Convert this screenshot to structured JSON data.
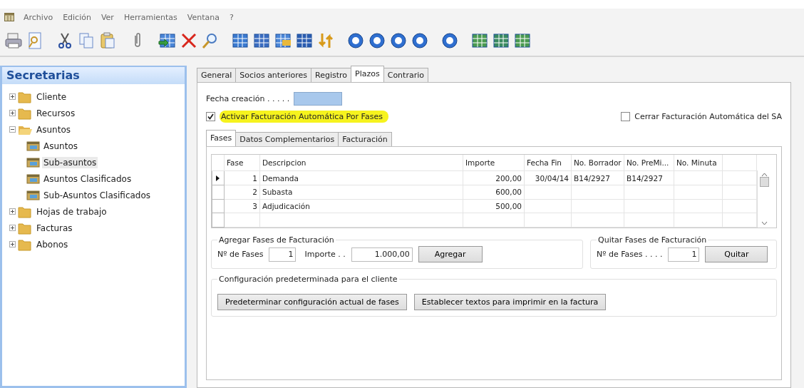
{
  "menu": [
    "Archivo",
    "Edición",
    "Ver",
    "Herramientas",
    "Ventana",
    "?"
  ],
  "sidebar": {
    "title": "Secretarias",
    "items": [
      {
        "label": "Cliente",
        "kind": "folder",
        "expanded": false
      },
      {
        "label": "Recursos",
        "kind": "folder",
        "expanded": false
      },
      {
        "label": "Asuntos",
        "kind": "folder",
        "expanded": true,
        "children": [
          {
            "label": "Asuntos",
            "kind": "table",
            "selected": false
          },
          {
            "label": "Sub-asuntos",
            "kind": "table",
            "selected": true
          },
          {
            "label": "Asuntos Clasificados",
            "kind": "table",
            "selected": false
          },
          {
            "label": "Sub-Asuntos Clasificados",
            "kind": "table",
            "selected": false
          }
        ]
      },
      {
        "label": "Hojas de trabajo",
        "kind": "folder",
        "expanded": false
      },
      {
        "label": "Facturas",
        "kind": "folder",
        "expanded": false
      },
      {
        "label": "Abonos",
        "kind": "folder",
        "expanded": false
      }
    ]
  },
  "tabs": [
    {
      "label": "General",
      "selected": false
    },
    {
      "label": "Socios anteriores",
      "selected": false
    },
    {
      "label": "Registro",
      "selected": false
    },
    {
      "label": "Plazos",
      "selected": true
    },
    {
      "label": "Contrario",
      "selected": false
    }
  ],
  "fecha_creacion": {
    "label": "Fecha creación . . . . ."
  },
  "checkboxes": [
    {
      "label": "Activar Facturación Automática Por Fases",
      "checked": true,
      "highlighted": true
    },
    {
      "label": "Cerrar Facturación Automática del SA",
      "checked": false,
      "highlighted": false
    }
  ],
  "subtabs": [
    {
      "label": "Fases",
      "selected": true
    },
    {
      "label": "Datos Complementarios",
      "selected": false
    },
    {
      "label": "Facturación",
      "selected": false
    }
  ],
  "table": {
    "columns": [
      "Fase",
      "Descripcion",
      "Importe",
      "Fecha Fin",
      "No. Borrador",
      "No. PreMi...",
      "No. Minuta"
    ],
    "rows": [
      {
        "current": true,
        "cells": [
          "1",
          "Demanda",
          "200,00",
          "30/04/14",
          "B14/2927",
          "B14/2927",
          ""
        ]
      },
      {
        "current": false,
        "cells": [
          "2",
          "Subasta",
          "600,00",
          "",
          "",
          "",
          ""
        ]
      },
      {
        "current": false,
        "cells": [
          "3",
          "Adjudicación",
          "500,00",
          "",
          "",
          "",
          ""
        ]
      },
      {
        "current": false,
        "cells": [
          "",
          "",
          "",
          "",
          "",
          "",
          ""
        ]
      }
    ]
  },
  "agregar": {
    "title": "Agregar Fases de Facturación",
    "fases_label": "Nº de Fases",
    "fases_value": "1",
    "importe_label": "Importe . .",
    "importe_value": "1.000,00",
    "button": "Agregar"
  },
  "quitar": {
    "title": "Quitar Fases de Facturación",
    "fases_label": "Nº de Fases . . . .",
    "fases_value": "1",
    "button": "Quitar"
  },
  "configuracion": {
    "title": "Configuración predeterminada para el cliente",
    "buttons": [
      "Predeterminar configuración actual de fases",
      "Establecer textos para imprimir en la  factura"
    ]
  }
}
